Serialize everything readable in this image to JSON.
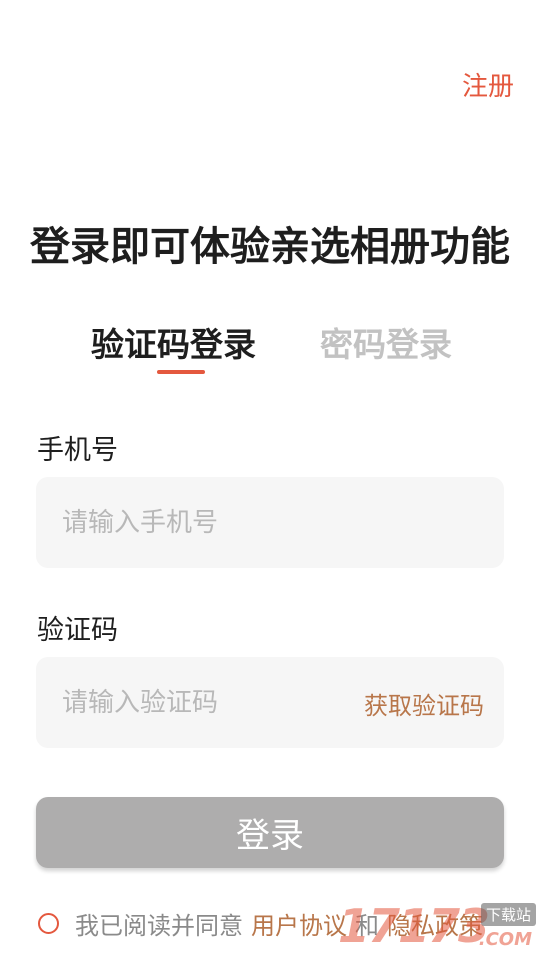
{
  "header": {
    "register_label": "注册"
  },
  "title": "登录即可体验亲选相册功能",
  "tabs": [
    {
      "label": "验证码登录",
      "active": true
    },
    {
      "label": "密码登录",
      "active": false
    }
  ],
  "form": {
    "phone": {
      "label": "手机号",
      "value": "",
      "placeholder": "请输入手机号"
    },
    "code": {
      "label": "验证码",
      "value": "",
      "placeholder": "请输入验证码",
      "get_code_label": "获取验证码"
    },
    "login_label": "登录"
  },
  "agreement": {
    "prefix": "我已阅读并同意",
    "user_agreement": "用户协议",
    "and": "和",
    "privacy_policy": "隐私政策"
  },
  "watermark": {
    "number": "17173",
    "tag": "下载站",
    "domain": ".COM"
  },
  "colors": {
    "accent": "#e4583e",
    "link": "#b8764a",
    "button_disabled": "#aeadad",
    "input_bg": "#f6f6f6"
  }
}
